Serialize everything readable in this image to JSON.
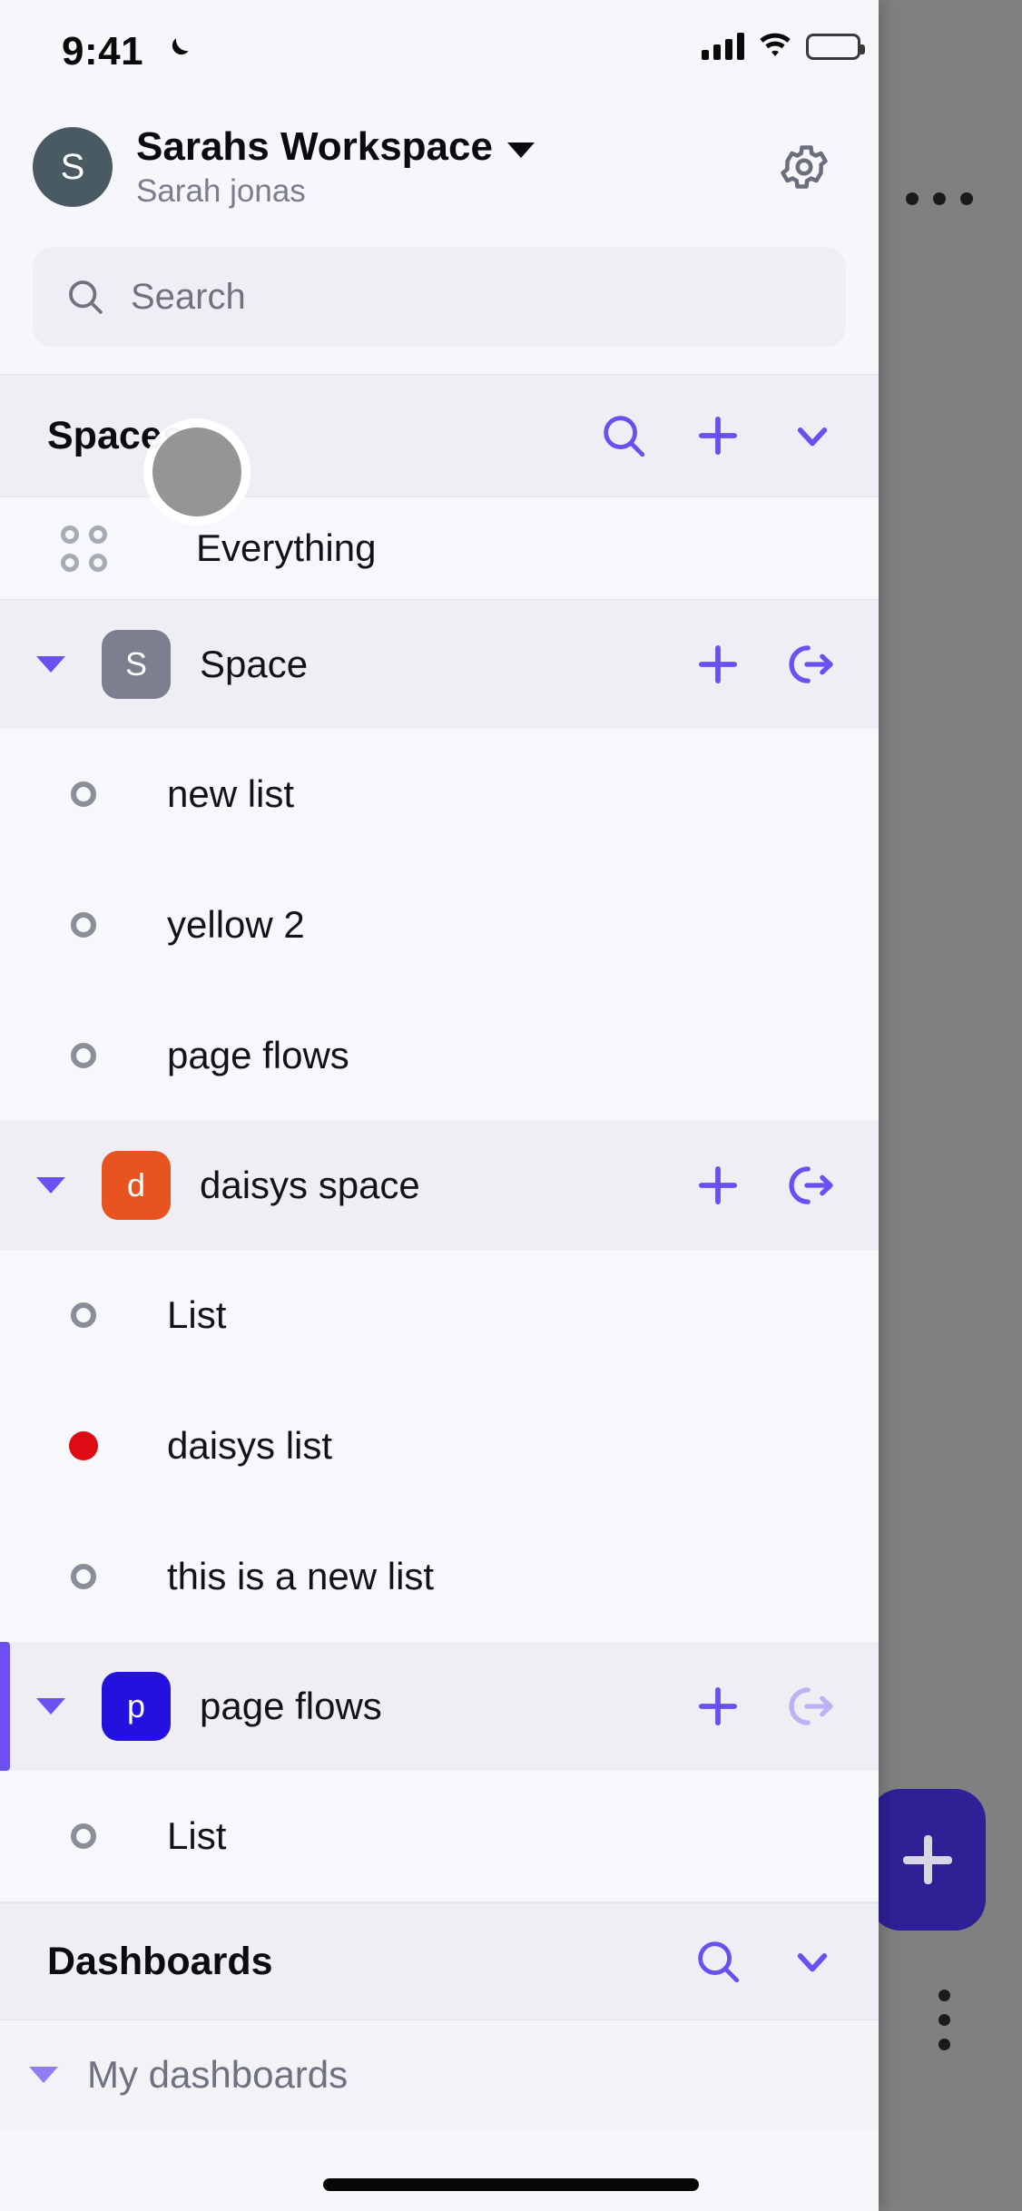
{
  "status_bar": {
    "time": "9:41",
    "moon_icon": "crescent-moon-icon",
    "signal_icon": "cellular-signal-icon",
    "wifi_icon": "wifi-icon",
    "battery_icon": "battery-full-icon"
  },
  "workspace": {
    "avatar_initial": "S",
    "avatar_color": "#4a5a62",
    "title": "Sarahs Workspace",
    "subtitle": "Sarah jonas",
    "dropdown_icon": "chevron-down-icon",
    "settings_icon": "gear-icon"
  },
  "search": {
    "placeholder": "Search",
    "value": "",
    "icon": "search-icon"
  },
  "spaces_section": {
    "title": "Spaces",
    "actions": [
      "search-icon",
      "plus-icon",
      "chevron-down-icon"
    ],
    "accent_color": "#6c4ff0"
  },
  "everything_row": {
    "label": "Everything",
    "icon": "grid-dots-icon"
  },
  "spaces": [
    {
      "name": "Space",
      "badge_letter": "S",
      "badge_color": "#7c7f8d",
      "expanded": true,
      "active": false,
      "exit_icon_dim": false,
      "actions": [
        "plus-icon",
        "open-space-icon"
      ],
      "lists": [
        {
          "label": "new list",
          "dot": "hollow",
          "dot_color": "#8b8d98"
        },
        {
          "label": "yellow 2",
          "dot": "hollow",
          "dot_color": "#8b8d98"
        },
        {
          "label": "page flows",
          "dot": "hollow",
          "dot_color": "#8b8d98"
        }
      ]
    },
    {
      "name": "daisys space",
      "badge_letter": "d",
      "badge_color": "#e8541f",
      "expanded": true,
      "active": false,
      "exit_icon_dim": false,
      "actions": [
        "plus-icon",
        "open-space-icon"
      ],
      "lists": [
        {
          "label": "List",
          "dot": "hollow",
          "dot_color": "#8b8d98"
        },
        {
          "label": "daisys list",
          "dot": "filled",
          "dot_color": "#dd0b14"
        },
        {
          "label": "this is a new list",
          "dot": "hollow",
          "dot_color": "#8b8d98"
        }
      ]
    },
    {
      "name": "page flows",
      "badge_letter": "p",
      "badge_color": "#2311e0",
      "expanded": true,
      "active": true,
      "exit_icon_dim": true,
      "actions": [
        "plus-icon",
        "open-space-icon"
      ],
      "lists": [
        {
          "label": "List",
          "dot": "hollow",
          "dot_color": "#8b8d98"
        }
      ]
    }
  ],
  "dashboards_section": {
    "title": "Dashboards",
    "actions": [
      "search-icon",
      "chevron-down-icon"
    ],
    "items": [
      {
        "label": "My dashboards",
        "expanded": true
      }
    ]
  },
  "backdrop": {
    "overflow_menu_icon": "ellipsis-horizontal-icon",
    "fab_icon": "plus-icon",
    "fab_color": "#2e2196",
    "side_menu_icon": "ellipsis-vertical-icon"
  },
  "cursor": {
    "type": "touch-indicator"
  }
}
